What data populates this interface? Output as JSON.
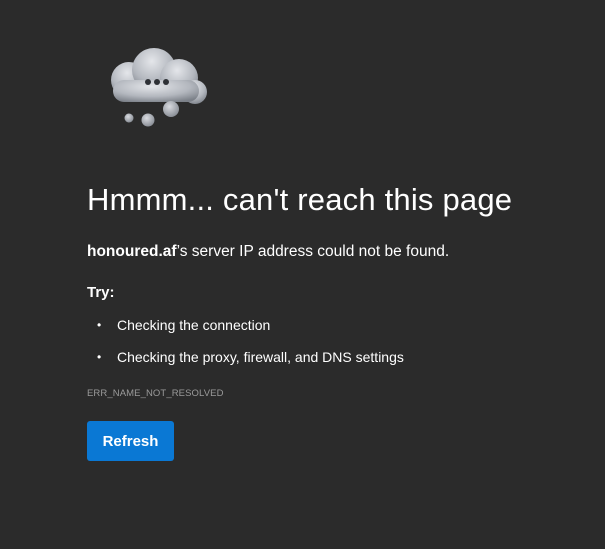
{
  "page": {
    "icon": "thinking-cloud-icon",
    "title": "Hmmm... can't reach this page",
    "description": {
      "host": "honoured.af",
      "message": "’s server IP address could not be found."
    },
    "try_label": "Try:",
    "suggestions": [
      "Checking the connection",
      "Checking the proxy, firewall, and DNS settings"
    ],
    "bullet": "•",
    "error_code": "ERR_NAME_NOT_RESOLVED",
    "refresh_label": "Refresh"
  },
  "colors": {
    "background": "#2b2b2b",
    "text": "#ffffff",
    "muted": "#9a9a9a",
    "accent": "#0a78d4"
  }
}
